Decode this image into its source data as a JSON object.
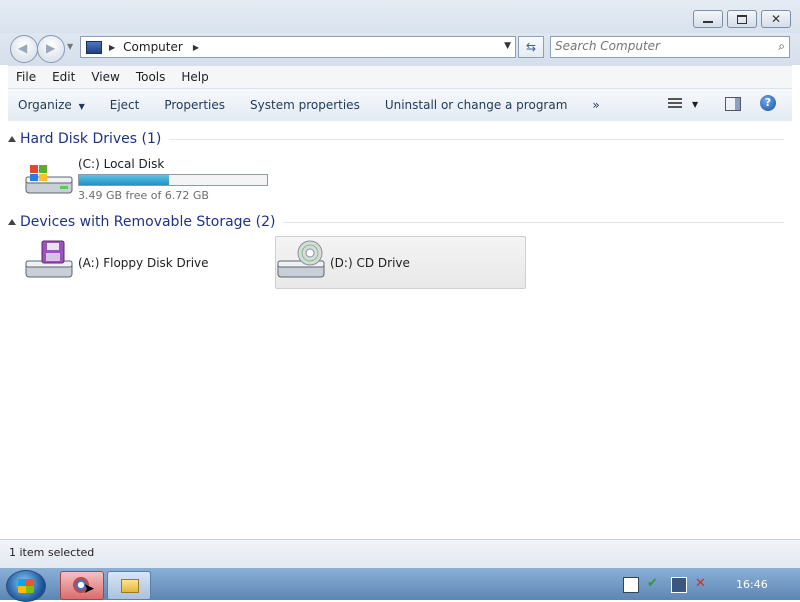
{
  "window": {
    "caption_buttons": [
      "minimize",
      "maximize",
      "close"
    ]
  },
  "address_bar": {
    "path_root_icon": "computer-icon",
    "path": "Computer",
    "search_placeholder": "Search Computer"
  },
  "menu": {
    "items": [
      {
        "label": "File",
        "key": "F"
      },
      {
        "label": "Edit",
        "key": "E"
      },
      {
        "label": "View",
        "key": "V"
      },
      {
        "label": "Tools",
        "key": "T"
      },
      {
        "label": "Help",
        "key": "H"
      }
    ]
  },
  "toolbar": {
    "organize": "Organize",
    "eject": "Eject",
    "properties": "Properties",
    "system_properties": "System properties",
    "uninstall": "Uninstall or change a program",
    "more": "»"
  },
  "groups": {
    "hard_disk": {
      "title": "Hard Disk Drives (1)",
      "drives": [
        {
          "name": "(C:) Local Disk",
          "free_text": "3.49 GB free of 6.72 GB",
          "used_fraction": 0.48
        }
      ]
    },
    "removable": {
      "title": "Devices with Removable Storage (2)",
      "drives": [
        {
          "name": "(A:) Floppy Disk Drive"
        },
        {
          "name": "(D:) CD Drive"
        }
      ]
    }
  },
  "status": {
    "text": "1 item selected"
  },
  "taskbar": {
    "clock": "16:46"
  },
  "colors": {
    "group_title": "#1e3287",
    "accent": "#2590c4"
  }
}
